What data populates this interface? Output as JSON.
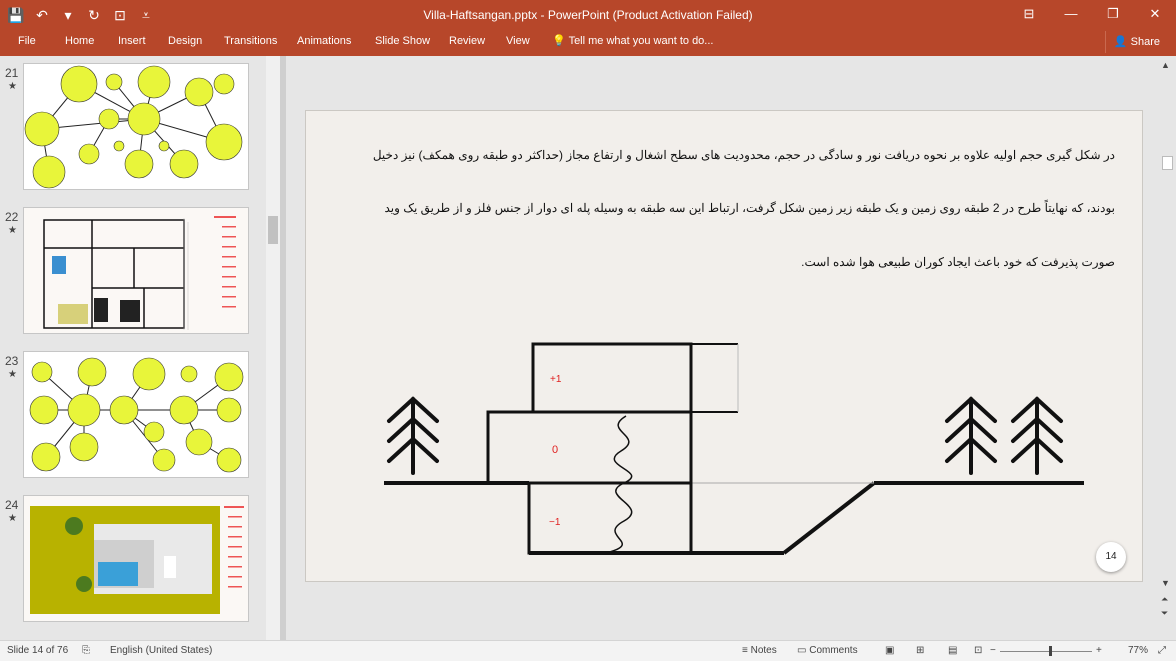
{
  "window": {
    "title": "Villa-Haftsangan.pptx  -  PowerPoint (Product Activation Failed)",
    "qat": [
      "💾",
      "↶",
      "▾",
      "↻",
      "⊡",
      "⩡"
    ],
    "controls": [
      "⊟",
      "—",
      "❐",
      "✕"
    ]
  },
  "ribbon": {
    "tabs": [
      "File",
      "Home",
      "Insert",
      "Design",
      "Transitions",
      "Animations",
      "Slide Show",
      "Review",
      "View"
    ],
    "tell_me": "Tell me what you want to do...",
    "share": "Share"
  },
  "thumbnails": [
    {
      "number": "21",
      "star": "★"
    },
    {
      "number": "22",
      "star": "★"
    },
    {
      "number": "23",
      "star": "★"
    },
    {
      "number": "24",
      "star": "★"
    }
  ],
  "slide": {
    "lines": [
      "در شکل گیری حجم اولیه علاوه بر نحوه دریافت نور و سادگی در حجم، محدودیت های سطح اشغال و ارتفاع مجاز (حداکثر دو طبقه روی همکف) نیز دخیل",
      "بودند، که نهایتاً طرح در 2 طبقه روی زمین و یک طبقه زیر زمین شکل گرفت، ارتباط این سه طبقه به وسیله پله ای دوار از جنس فلز و از طریق یک وید",
      "صورت پذیرفت که خود باعث ایجاد کوران طبیعی هوا شده است."
    ],
    "levels": [
      "+1",
      "0",
      "−1"
    ],
    "page_number": "14"
  },
  "status": {
    "slide_info": "Slide 14 of 76",
    "language": "English (United States)",
    "notes": "Notes",
    "comments": "Comments",
    "zoom": "77%"
  },
  "colors": {
    "brand": "#b7472a",
    "level_label": "#e02020",
    "bubble": "#e8f53a"
  }
}
